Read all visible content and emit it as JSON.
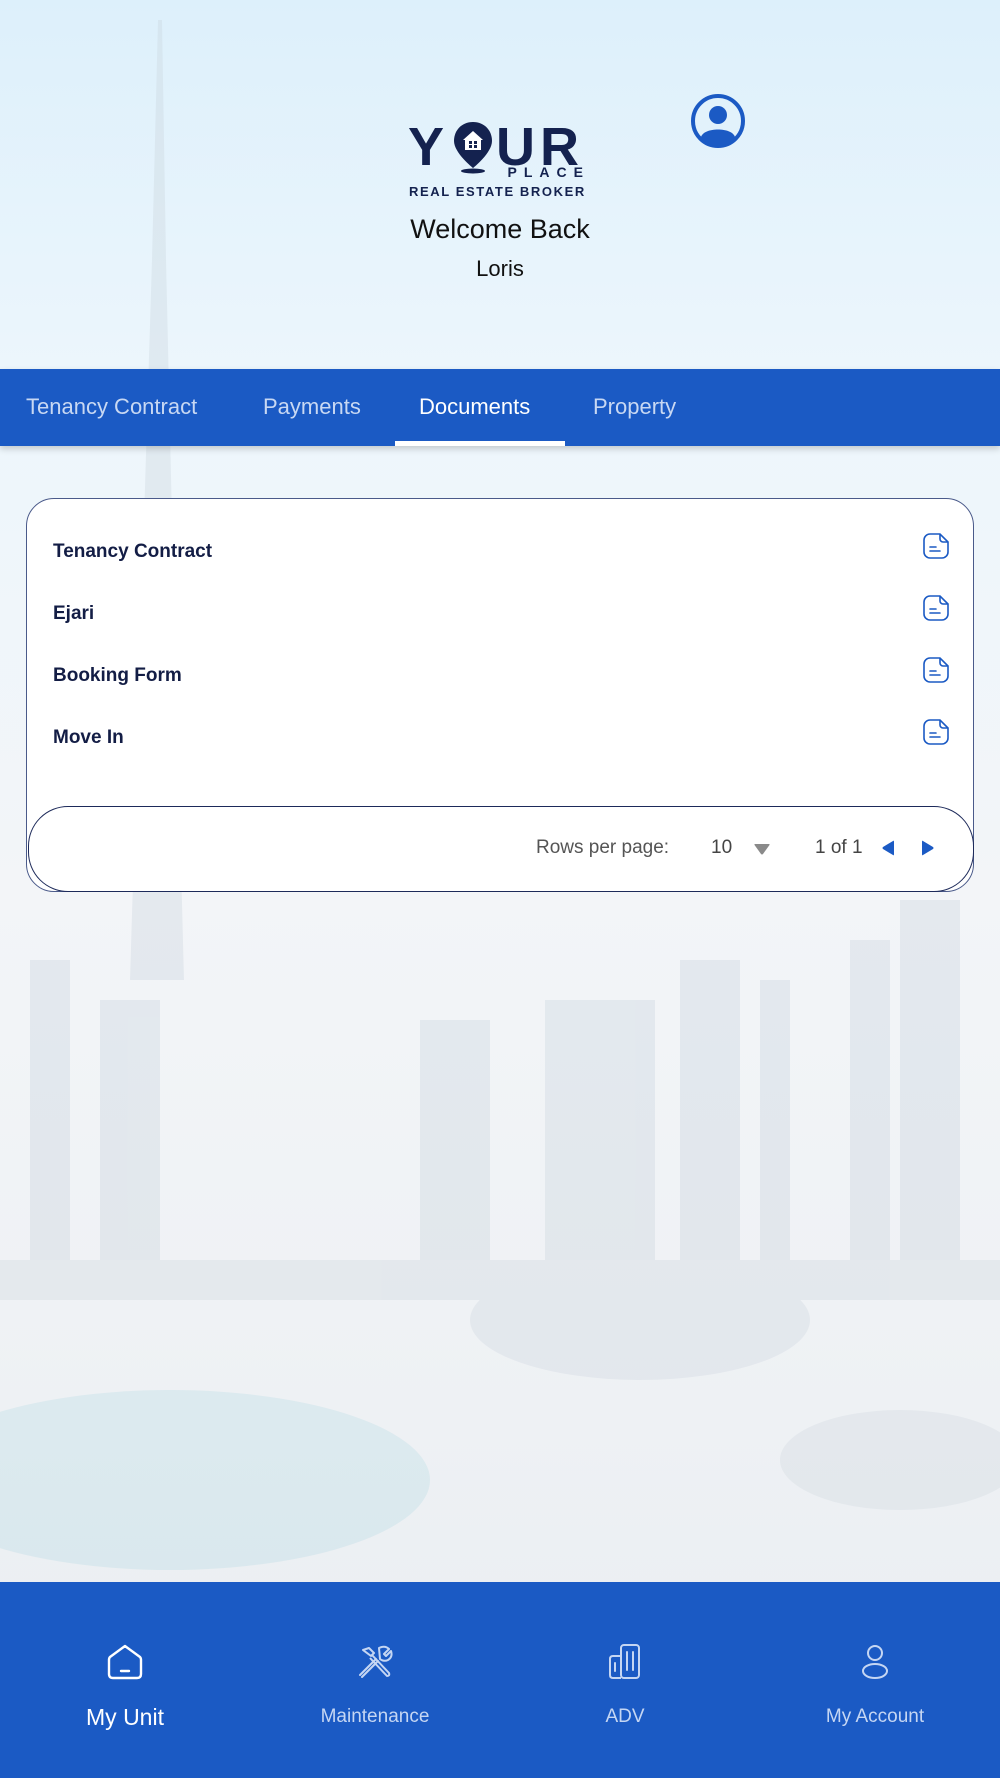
{
  "logo": {
    "word": "YOUR",
    "place": "PLACE",
    "subtitle": "REAL ESTATE BROKER"
  },
  "header": {
    "welcome": "Welcome Back",
    "username": "Loris",
    "profile_icon": "user-circle-icon"
  },
  "tabs": [
    {
      "label": "Tenancy Contract",
      "active": false
    },
    {
      "label": "Payments",
      "active": false
    },
    {
      "label": "Documents",
      "active": true
    },
    {
      "label": "Property",
      "active": false
    }
  ],
  "documents": [
    {
      "label": "Tenancy Contract",
      "icon": "document-icon"
    },
    {
      "label": "Ejari",
      "icon": "document-icon"
    },
    {
      "label": "Booking Form",
      "icon": "document-icon"
    },
    {
      "label": "Move In",
      "icon": "document-icon"
    }
  ],
  "pagination": {
    "rows_label": "Rows per page:",
    "rows_value": "10",
    "range": "1 of 1"
  },
  "bottom_nav": [
    {
      "label": "My Unit",
      "icon": "home-icon",
      "active": true
    },
    {
      "label": "Maintenance",
      "icon": "tools-icon",
      "active": false
    },
    {
      "label": "ADV",
      "icon": "building-icon",
      "active": false
    },
    {
      "label": "My Account",
      "icon": "user-icon",
      "active": false
    }
  ],
  "colors": {
    "primary": "#1b5ac4",
    "navy": "#14224f",
    "tab_inactive": "#c8d8f3"
  }
}
